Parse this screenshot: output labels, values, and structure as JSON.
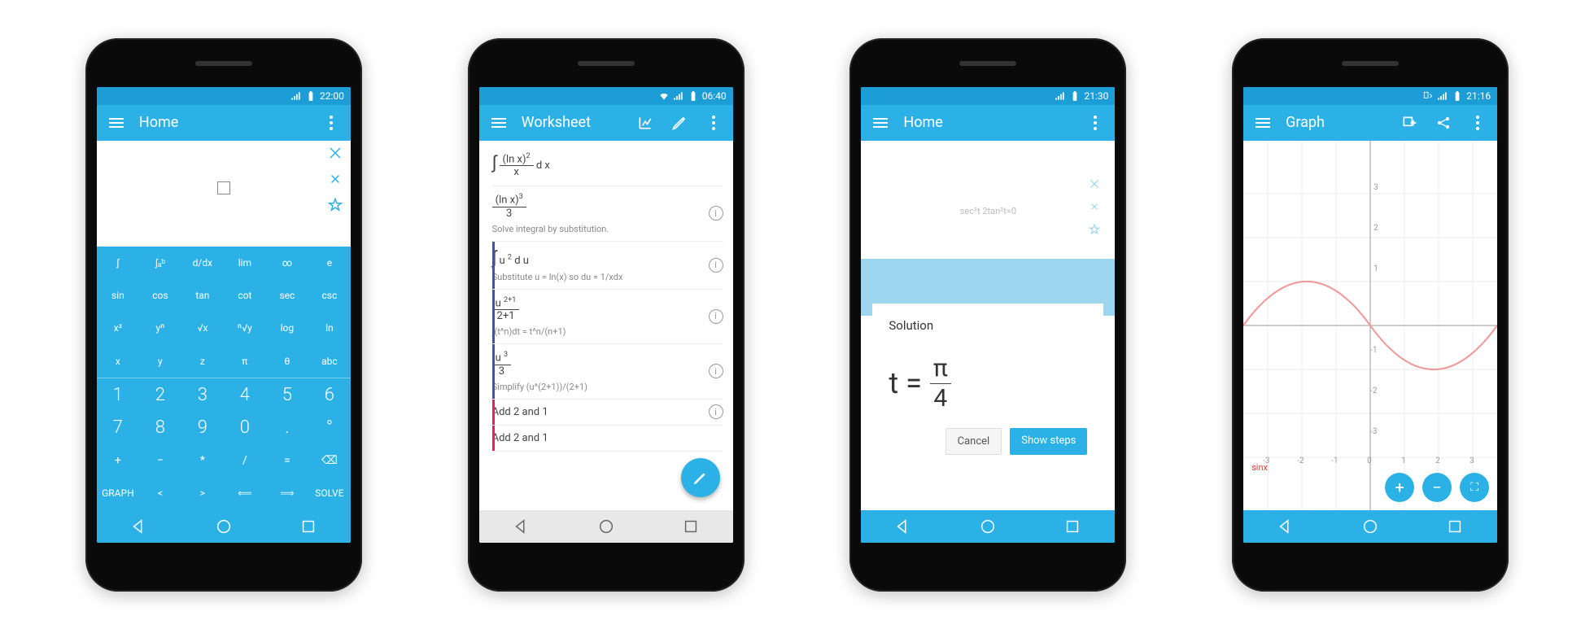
{
  "s1": {
    "status_time": "22:00",
    "title": "Home",
    "rows": [
      [
        "∫",
        "∫ₐᵇ",
        "d/dx",
        "lim",
        "∞",
        "e"
      ],
      [
        "sin",
        "cos",
        "tan",
        "cot",
        "sec",
        "csc"
      ],
      [
        "x²",
        "yⁿ",
        "√x",
        "ⁿ√y",
        "log",
        "ln"
      ],
      [
        "x",
        "y",
        "z",
        "π",
        "θ",
        "abc"
      ],
      [
        "1",
        "2",
        "3",
        "4",
        "5",
        "6"
      ],
      [
        "7",
        "8",
        "9",
        "0",
        ".",
        "°"
      ],
      [
        "+",
        "−",
        "*",
        "/",
        "=",
        "⌫"
      ],
      [
        "GRAPH",
        "<",
        ">",
        "⟸",
        "⟹",
        "SOLVE"
      ]
    ]
  },
  "s2": {
    "status_time": "06:40",
    "title": "Worksheet",
    "items": [
      {
        "expr_html": "<span class='intg'>∫</span> <span class='frac'><span class='num'>(ln x)<span class='sup'>2</span></span><span class='den'>x</span></span> d x",
        "info": false
      },
      {
        "expr_html": "<span class='frac'><span class='num'>(ln x)<span class='sup'>3</span></span><span class='den'>3</span></span>",
        "sub": "Solve integral by substitution.",
        "info": true
      },
      {
        "bar": "blue",
        "expr_html": "<span class='intg'>∫</span> u <span class='sup'>2</span> d u",
        "sub": "Substitute u = ln(x) so du = 1/xdx",
        "info": true
      },
      {
        "bar": "blue",
        "expr_html": "<span class='frac'><span class='num'>u <span class='sup'>2+1</span></span><span class='den'>2+1</span></span>",
        "sub": "∫(t^n)dt = t^n/(n+1)",
        "info": true
      },
      {
        "bar": "blue",
        "expr_html": "<span class='frac'><span class='num'>u <span class='sup'>3</span></span><span class='den'>3</span></span>",
        "sub": "Simplify (u^(2+1))/(2+1)",
        "info": true
      },
      {
        "bar": "pink",
        "expr_html": "Add 2 and 1",
        "info": true
      },
      {
        "bar": "pink",
        "expr_html": "Add 2 and 1",
        "info": false
      }
    ]
  },
  "s3": {
    "status_time": "21:30",
    "title": "Home",
    "back_expr": "sec²t 2tan²t=0",
    "modal_title": "Solution",
    "eq_lhs": "t =",
    "eq_num": "π",
    "eq_den": "4",
    "cancel": "Cancel",
    "show": "Show steps"
  },
  "s4": {
    "status_time": "21:16",
    "title": "Graph",
    "legend": "sinx",
    "xticks": [
      "-3",
      "-2",
      "-1",
      "0",
      "1",
      "2",
      "3"
    ],
    "yticks": [
      "3",
      "2",
      "1",
      "-1",
      "-2",
      "-3"
    ]
  }
}
